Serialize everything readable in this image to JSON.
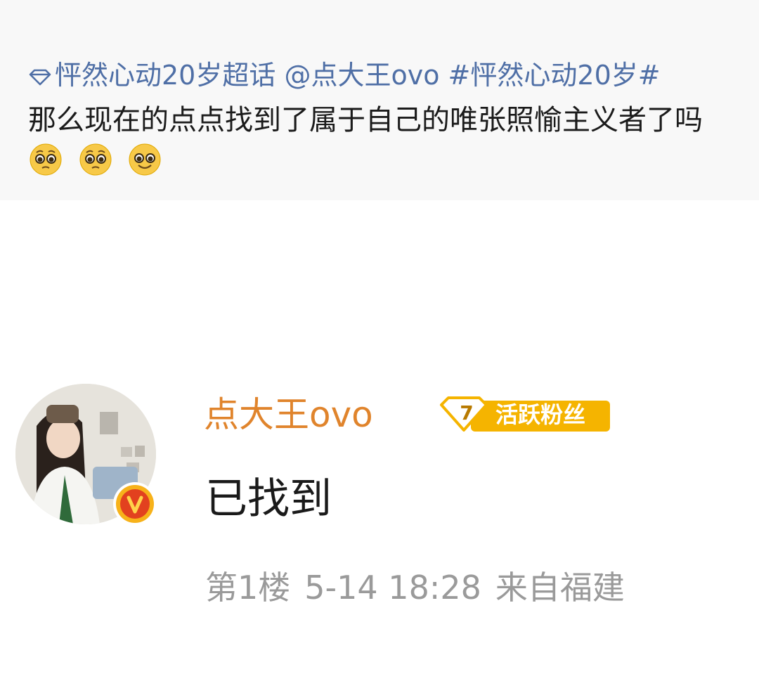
{
  "post": {
    "topic": "怦然心动20岁超话",
    "mention": "@点大王ovo",
    "hashtag": "#怦然心动20岁#",
    "text": "那么现在的点点找到了属于自己的唯张照愉主义者了吗",
    "emojis": [
      "pleading-face",
      "pleading-face",
      "smiling-tear-face"
    ]
  },
  "comment": {
    "username": "点大王ovo",
    "fan_badge": {
      "level": "7",
      "label": "活跃粉丝"
    },
    "reply": "已找到",
    "floor": "第1楼",
    "datetime": "5-14 18:28",
    "location": "来自福建"
  },
  "colors": {
    "link": "#4f6fa6",
    "username": "#e0842c",
    "badge": "#f5b400",
    "meta": "#9a9a9a"
  }
}
